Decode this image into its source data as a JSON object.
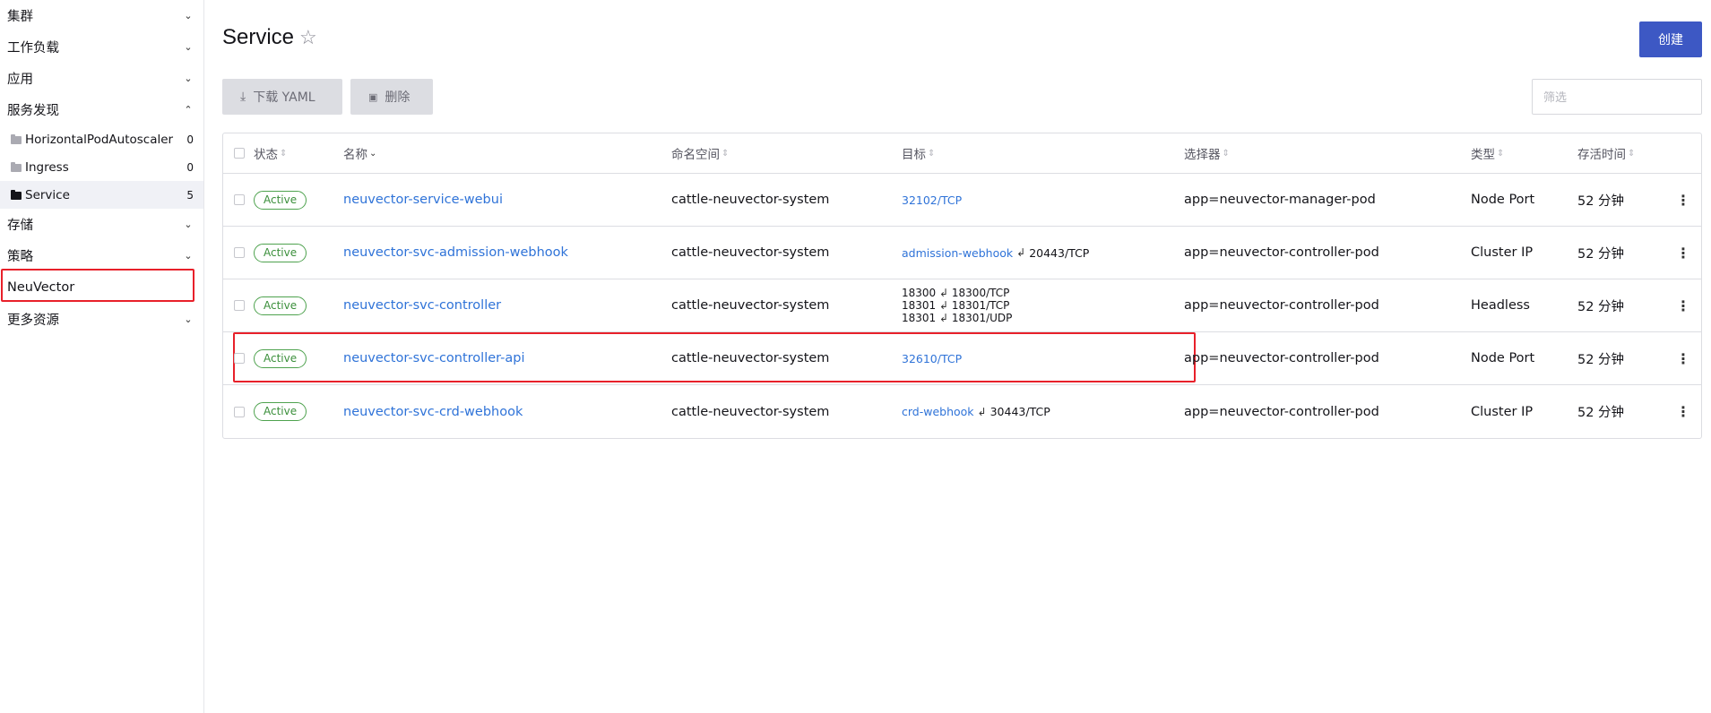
{
  "sidebar": {
    "groups": [
      {
        "label": "集群"
      },
      {
        "label": "工作负载"
      },
      {
        "label": "应用"
      },
      {
        "label": "服务发现"
      }
    ],
    "sub_items": [
      {
        "label": "HorizontalPodAutoscaler",
        "count": "0"
      },
      {
        "label": "Ingress",
        "count": "0"
      },
      {
        "label": "Service",
        "count": "5"
      }
    ],
    "groups_after": [
      {
        "label": "存储"
      },
      {
        "label": "策略"
      }
    ],
    "neuvector": "NeuVector",
    "more": "更多资源"
  },
  "page": {
    "title": "Service",
    "create": "创建",
    "download_yaml": "下载 YAML",
    "delete": "删除",
    "filter_placeholder": "筛选"
  },
  "table": {
    "headers": {
      "state": "状态",
      "name": "名称",
      "namespace": "命名空间",
      "target": "目标",
      "selector": "选择器",
      "type": "类型",
      "age": "存活时间"
    },
    "rows": [
      {
        "state": "Active",
        "name": "neuvector-service-webui",
        "namespace": "cattle-neuvector-system",
        "target_link": "32102/TCP",
        "selector": "app=neuvector-manager-pod",
        "type": "Node Port",
        "age": "52 分钟"
      },
      {
        "state": "Active",
        "name": "neuvector-svc-admission-webhook",
        "namespace": "cattle-neuvector-system",
        "target_link": "admission-webhook",
        "target_port": "20443/TCP",
        "selector": "app=neuvector-controller-pod",
        "type": "Cluster IP",
        "age": "52 分钟"
      },
      {
        "state": "Active",
        "name": "neuvector-svc-controller",
        "namespace": "cattle-neuvector-system",
        "target_lines": [
          {
            "from": "18300",
            "to": "18300/TCP"
          },
          {
            "from": "18301",
            "to": "18301/TCP"
          },
          {
            "from": "18301",
            "to": "18301/UDP"
          }
        ],
        "selector": "app=neuvector-controller-pod",
        "type": "Headless",
        "age": "52 分钟"
      },
      {
        "state": "Active",
        "name": "neuvector-svc-controller-api",
        "namespace": "cattle-neuvector-system",
        "target_link": "32610/TCP",
        "selector": "app=neuvector-controller-pod",
        "type": "Node Port",
        "age": "52 分钟"
      },
      {
        "state": "Active",
        "name": "neuvector-svc-crd-webhook",
        "namespace": "cattle-neuvector-system",
        "target_link": "crd-webhook",
        "target_port": "30443/TCP",
        "selector": "app=neuvector-controller-pod",
        "type": "Cluster IP",
        "age": "52 分钟"
      }
    ]
  },
  "colors": {
    "accent": "#3d58c4",
    "link": "#2f73d8",
    "active_badge": "#4ea24e",
    "highlight": "#e8202a"
  }
}
